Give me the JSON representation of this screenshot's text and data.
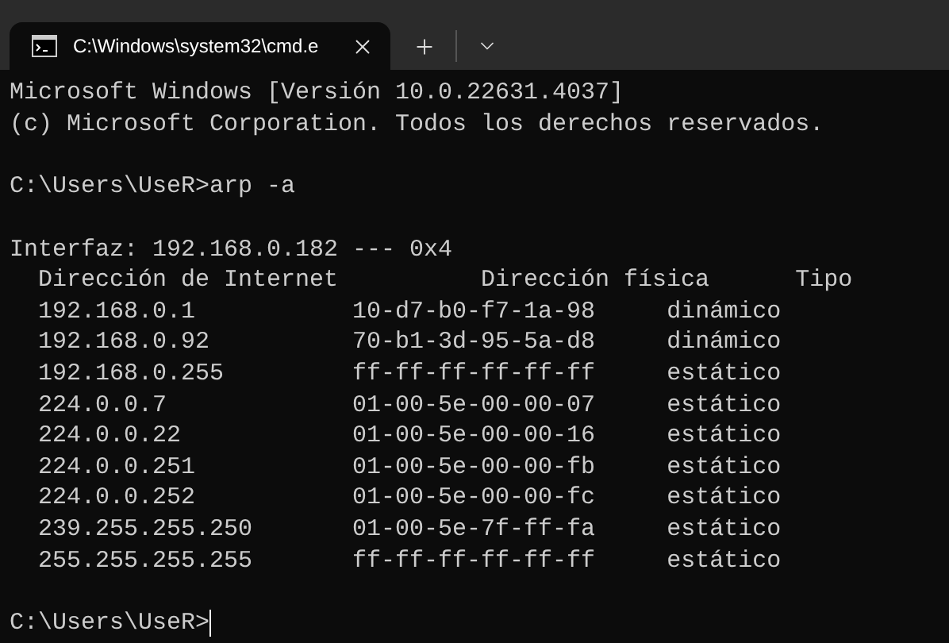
{
  "tabs": [
    {
      "title": "C:\\Windows\\system32\\cmd.e",
      "selected": true
    }
  ],
  "output": [
    "Microsoft Windows [Versión 10.0.22631.4037]",
    "(c) Microsoft Corporation. Todos los derechos reservados."
  ],
  "command": {
    "prompt": "C:\\Users\\UseR>",
    "text": "arp -a"
  },
  "interface": "Interfaz: 192.168.0.182 --- 0x4",
  "table": {
    "columns": [
      "Dirección de Internet",
      "Dirección física",
      "Tipo"
    ],
    "rows": [
      [
        "192.168.0.1",
        "10-d7-b0-f7-1a-98",
        "dinámico"
      ],
      [
        "192.168.0.92",
        "70-b1-3d-95-5a-d8",
        "dinámico"
      ],
      [
        "192.168.0.255",
        "ff-ff-ff-ff-ff-ff",
        "estático"
      ],
      [
        "224.0.0.7",
        "01-00-5e-00-00-07",
        "estático"
      ],
      [
        "224.0.0.22",
        "01-00-5e-00-00-16",
        "estático"
      ],
      [
        "224.0.0.251",
        "01-00-5e-00-00-fb",
        "estático"
      ],
      [
        "224.0.0.252",
        "01-00-5e-00-00-fc",
        "estático"
      ],
      [
        "239.255.255.250",
        "01-00-5e-7f-ff-fa",
        "estático"
      ],
      [
        "255.255.255.255",
        "ff-ff-ff-ff-ff-ff",
        "estático"
      ]
    ]
  },
  "prompt": "C:\\Users\\UseR>"
}
